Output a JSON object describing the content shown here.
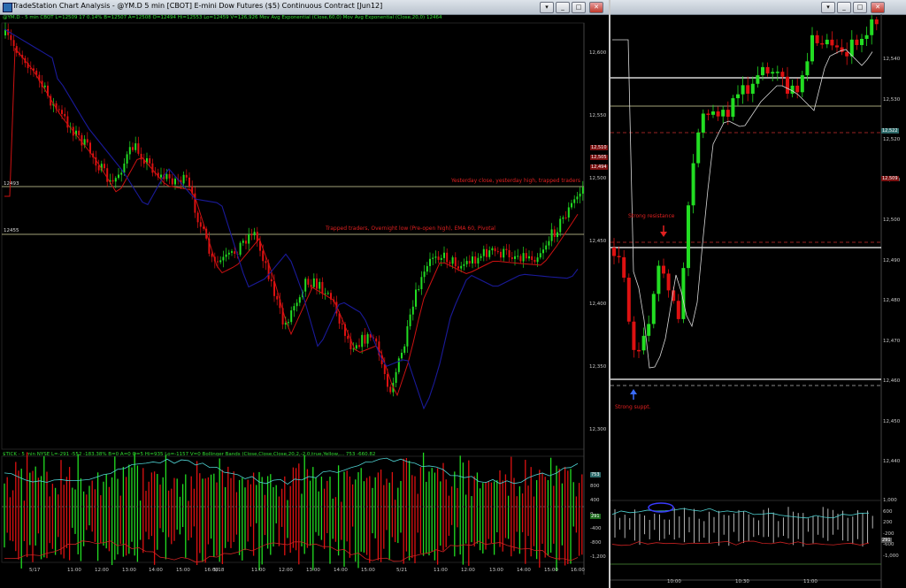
{
  "left_window": {
    "title": "TradeStation Chart Analysis - @YM.D 5 min [CBOT] E-mini Dow Futures ($5) Continuous Contract [Jun12]",
    "info_line": "@YM.D - 5 min  CBOT  L=12509  17  0.14%  B=12507  A=12508  O=12494  Hi=12553  Lo=12459  V=126,926  Mov Avg Exponential (Close,60,0)  Mov Avg Exponential (Close,20,0)  12464",
    "tick_info_line": "$TICK - 5 min  NYSE   L=-291  -552  -183.38%  B=0  A=0  O=5  Hi=935  Lo=-1157  V=0  Bollinger Bands (Close,Close,Close,20,2,-2,0,true,Yellow,...  753  -660.82",
    "price_axis": [
      "12,600",
      "12,550",
      "12,500",
      "12,450",
      "12,400",
      "12,350",
      "12,300"
    ],
    "tick_axis": [
      "800",
      "400",
      "0",
      "-400",
      "-800",
      "-1,200"
    ],
    "time_axis": [
      "5/17",
      "11:00",
      "12:00",
      "13:00",
      "14:00",
      "15:00",
      "16:00",
      "5/18",
      "11:00",
      "12:00",
      "13:00",
      "14:00",
      "15:00",
      "5/21",
      "11:00",
      "12:00",
      "13:00",
      "14:00",
      "15:00",
      "16:00"
    ],
    "hline_labels": [
      "12493",
      "12455"
    ],
    "annotations": [
      "Yesterday close, yesterday high, trapped traders",
      "Trapped traders, Overnight low (Pre-open high), EMA 60, Pivotal"
    ],
    "side_values": [
      "12,510",
      "12,505",
      "12,494"
    ],
    "tick_side_values": [
      "753",
      "291"
    ]
  },
  "right_window": {
    "price_axis": [
      "12,540",
      "12,530",
      "12,520",
      "12,510",
      "12,500",
      "12,490",
      "12,480",
      "12,470",
      "12,460",
      "12,450",
      "12,440"
    ],
    "tick_axis": [
      "1,000",
      "600",
      "200",
      "-200",
      "-600",
      "-1,000"
    ],
    "time_axis": [
      "10:00",
      "10:30",
      "11:00"
    ],
    "annotations": [
      "Strong resistance",
      "Strong suppt."
    ],
    "side_values": [
      "12,522",
      "12,509"
    ],
    "tick_side_values": [
      "291"
    ]
  },
  "colors": {
    "up": "#22dd22",
    "down": "#dd1111",
    "ema20": "#cc1111",
    "ema60": "#1a1a9a",
    "grid": "#333333",
    "white_line": "#ffffff",
    "yellow_line": "#d8d8a0"
  },
  "window_buttons": [
    "restore-icon",
    "minimize-icon",
    "close-icon"
  ]
}
